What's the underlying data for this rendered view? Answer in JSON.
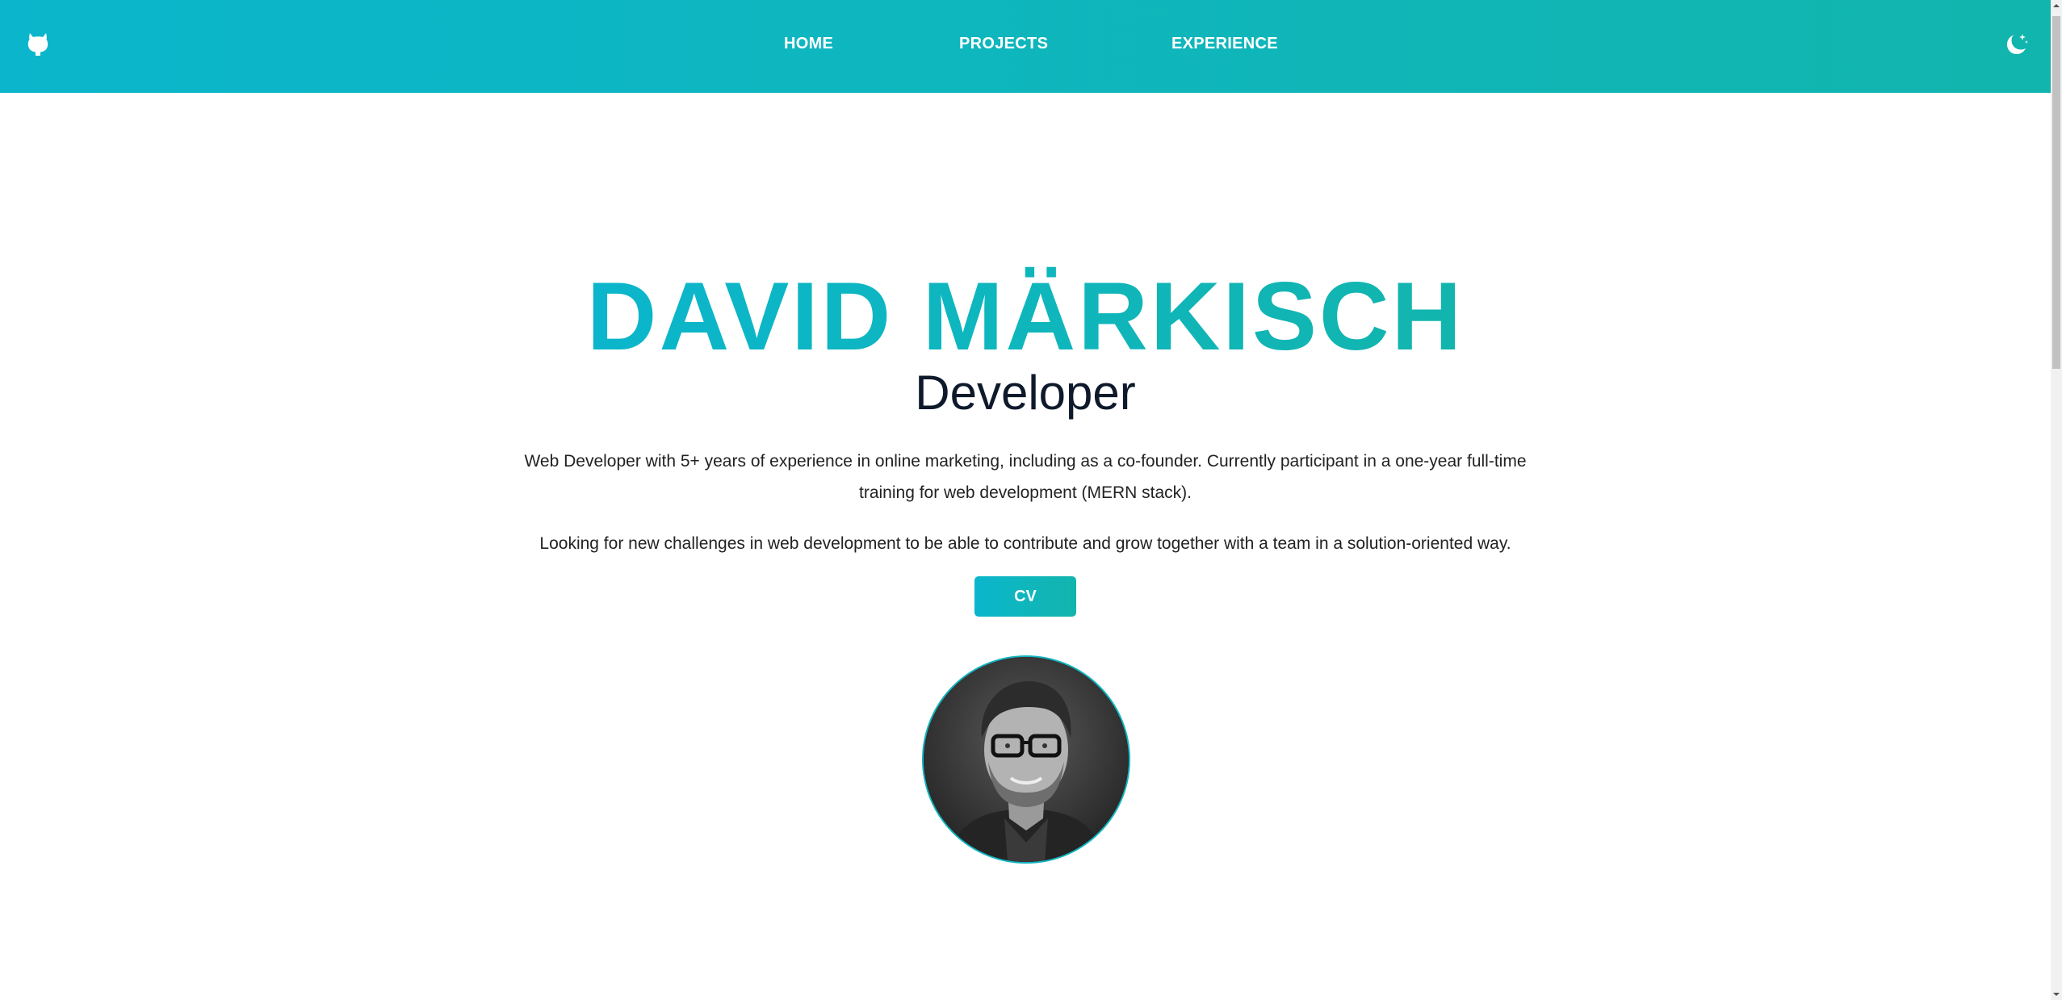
{
  "header": {
    "logo_icon": "github-icon",
    "nav": [
      {
        "label": "HOME"
      },
      {
        "label": "PROJECTS"
      },
      {
        "label": "EXPERIENCE"
      }
    ],
    "theme_toggle_icon": "moon-stars-icon"
  },
  "hero": {
    "name": "DAVID MÄRKISCH",
    "role": "Developer",
    "description": "Web Developer with 5+ years of experience in online marketing, including as a co-founder. Currently participant in a one-year full-time training for web development (MERN stack).",
    "goal": "Looking for new challenges in web development to be able to contribute and grow together with a team in a solution-oriented way.",
    "cv_label": "CV",
    "avatar_alt": "portrait-photo"
  },
  "colors": {
    "gradient_start": "#0bb6cc",
    "gradient_end": "#12b5ad",
    "role_text": "#0e1a2b",
    "body_text": "#222222"
  }
}
